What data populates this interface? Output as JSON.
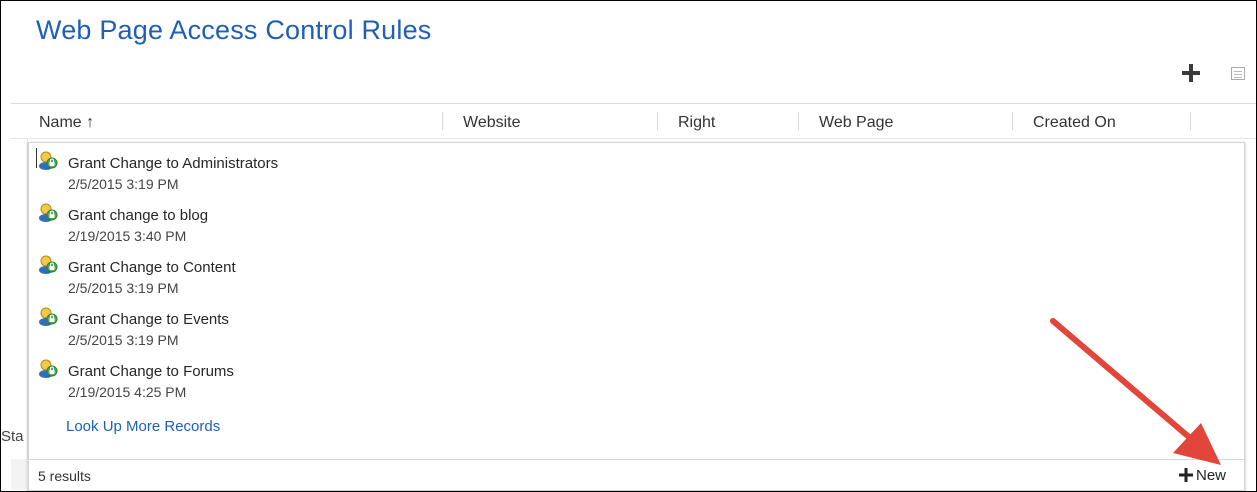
{
  "title": "Web Page Access Control Rules",
  "toolbar": {
    "add_icon": "plus-icon",
    "view_icon": "grid-view-icon"
  },
  "columns": [
    "Name ↑",
    "Website",
    "Right",
    "Web Page",
    "Created On"
  ],
  "status_partial": "Sta",
  "lookup": {
    "items": [
      {
        "name": "Grant Change to Administrators",
        "date": "2/5/2015 3:19 PM",
        "icon": "access-rule-icon"
      },
      {
        "name": "Grant change to blog",
        "date": "2/19/2015 3:40 PM",
        "icon": "access-rule-icon"
      },
      {
        "name": "Grant Change to Content",
        "date": "2/5/2015 3:19 PM",
        "icon": "access-rule-icon"
      },
      {
        "name": "Grant Change to Events",
        "date": "2/5/2015 3:19 PM",
        "icon": "access-rule-icon"
      },
      {
        "name": "Grant Change to Forums",
        "date": "2/19/2015 4:25 PM",
        "icon": "access-rule-icon"
      }
    ],
    "more_link": "Look Up More Records",
    "results": "5 results",
    "new_label": "New"
  },
  "colors": {
    "title": "#1f5fb5",
    "link": "#1f5fb5",
    "arrow": "#e2453a"
  }
}
